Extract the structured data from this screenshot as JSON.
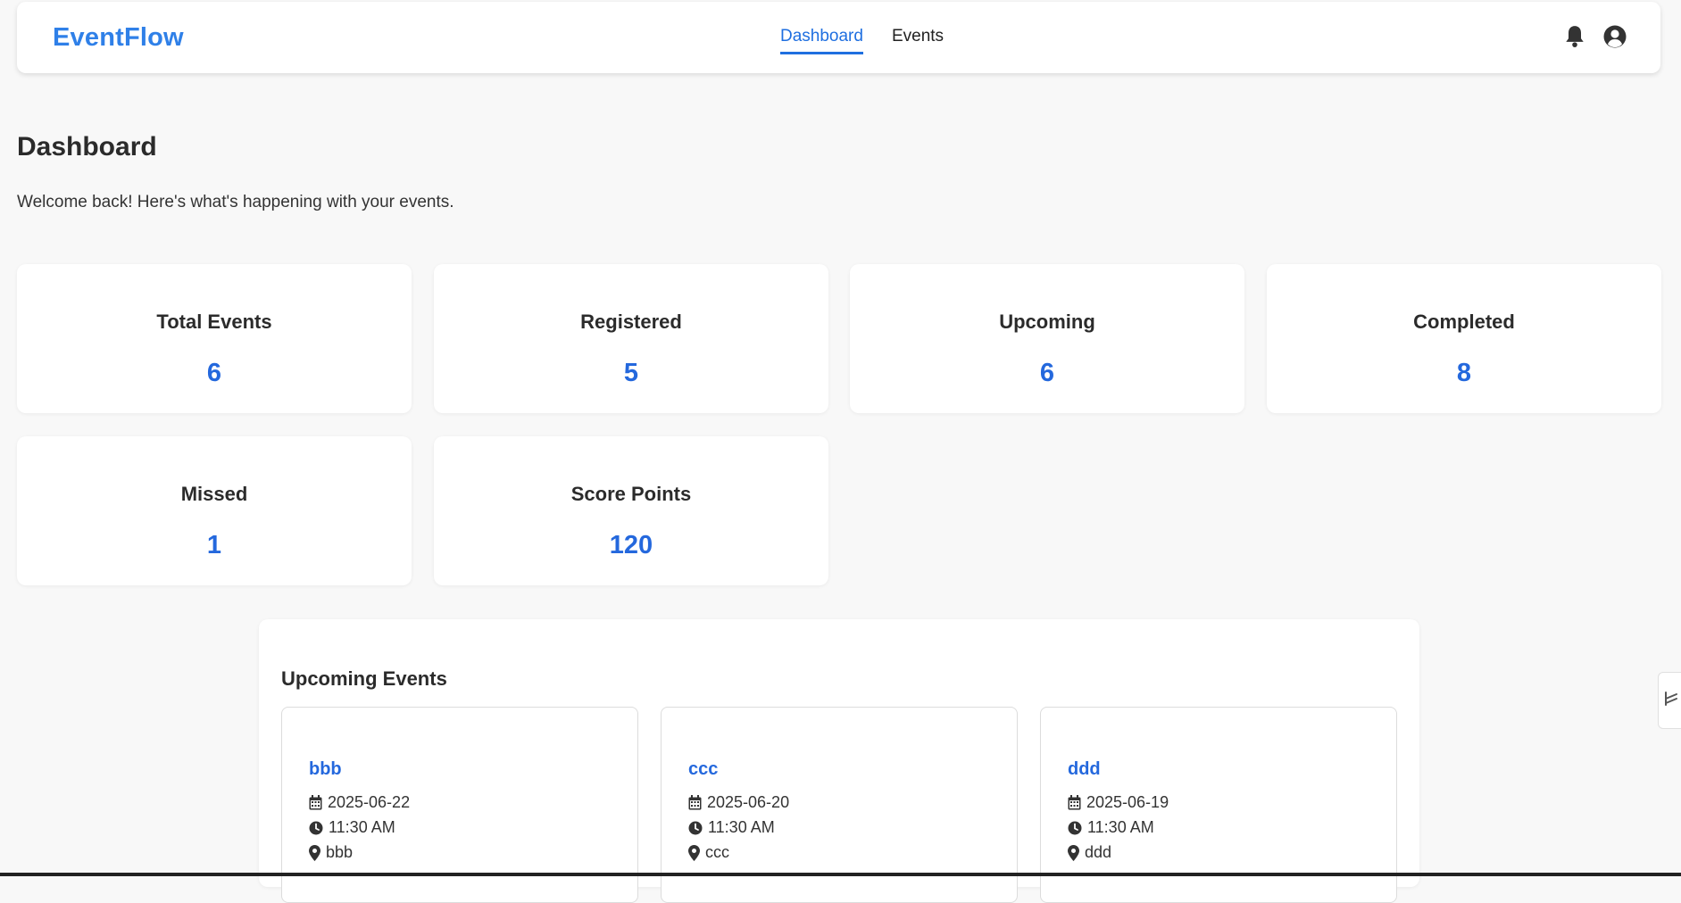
{
  "navbar": {
    "brand": "EventFlow",
    "links": [
      {
        "label": "Dashboard",
        "active": true
      },
      {
        "label": "Events",
        "active": false
      }
    ],
    "icons": [
      "bell-icon",
      "user-circle-icon"
    ]
  },
  "header": {
    "title": "Dashboard",
    "subtitle": "Welcome back! Here's what's happening with your events."
  },
  "stats": [
    {
      "label": "Total Events",
      "value": "6"
    },
    {
      "label": "Registered",
      "value": "5"
    },
    {
      "label": "Upcoming",
      "value": "6"
    },
    {
      "label": "Completed",
      "value": "8"
    },
    {
      "label": "Missed",
      "value": "1"
    },
    {
      "label": "Score Points",
      "value": "120"
    }
  ],
  "upcoming": {
    "title": "Upcoming Events",
    "events": [
      {
        "name": "bbb",
        "date": "2025-06-22",
        "time": "11:30 AM",
        "location": "bbb"
      },
      {
        "name": "ccc",
        "date": "2025-06-20",
        "time": "11:30 AM",
        "location": "ccc"
      },
      {
        "name": "ddd",
        "date": "2025-06-19",
        "time": "11:30 AM",
        "location": "ddd"
      }
    ]
  },
  "colors": {
    "brand": "#2f80e8",
    "accent": "#2468dd",
    "background": "#f8f8f8"
  }
}
